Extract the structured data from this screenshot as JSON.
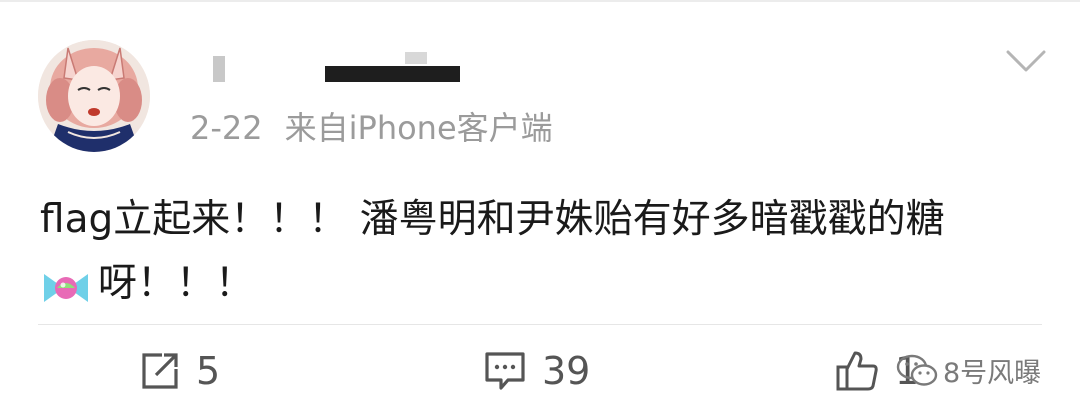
{
  "post": {
    "date": "2-22",
    "source": "来自iPhone客户端",
    "content_line1": "flag立起来！！！ 潘粤明和尹姝贻有好多暗戳戳的糖",
    "content_line2": "呀！！！"
  },
  "actions": {
    "repost_count": "5",
    "comment_count": "39",
    "like_count": "1"
  },
  "watermark": {
    "text": "8号风曝"
  },
  "icons": {
    "menu": "chevron-down-icon",
    "emoji": "candy-icon",
    "repost": "repost-icon",
    "comment": "comment-icon",
    "like": "thumbs-up-icon",
    "watermark": "wechat-icon"
  },
  "colors": {
    "meta_text": "#9b9b9b",
    "body_text": "#1a1a1a",
    "divider": "#e6e6e6"
  }
}
